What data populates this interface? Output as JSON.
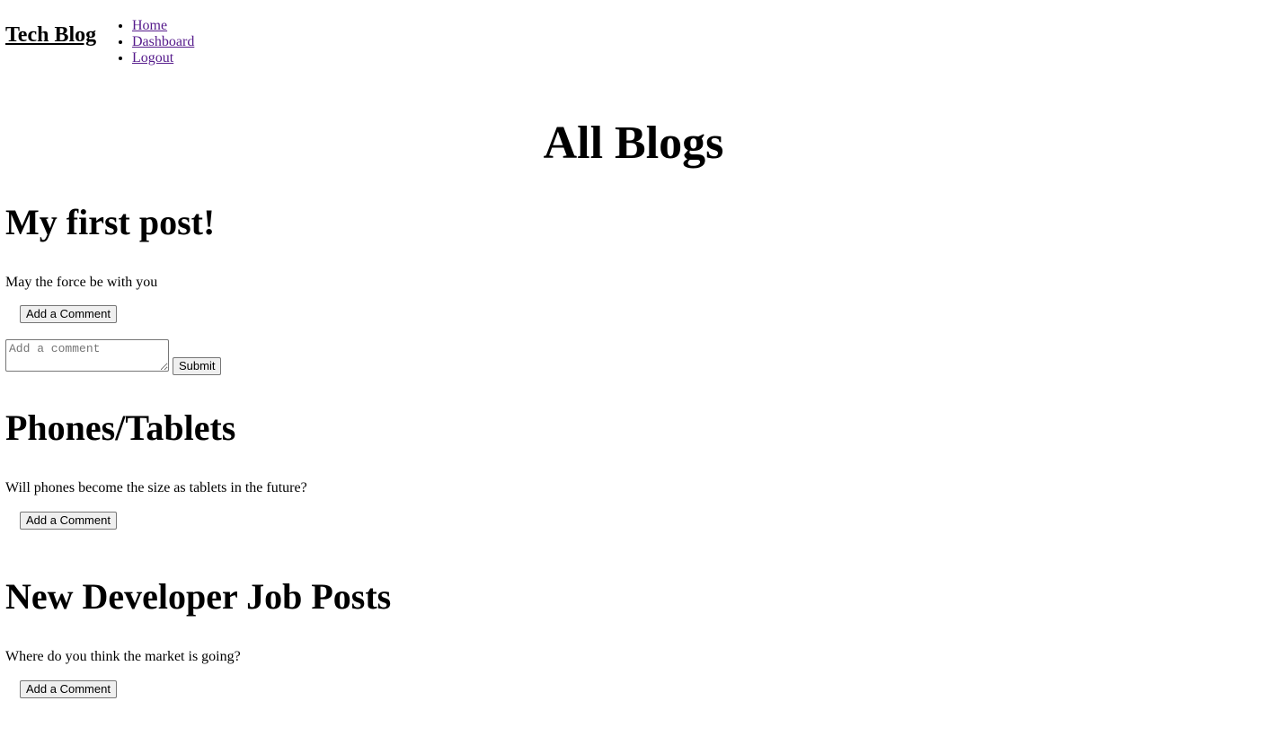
{
  "header": {
    "brand": "Tech Blog",
    "nav": [
      {
        "label": "Home"
      },
      {
        "label": "Dashboard"
      },
      {
        "label": "Logout"
      }
    ]
  },
  "main": {
    "title": "All Blogs",
    "posts": [
      {
        "title": "My first post!",
        "body": "May the force be with you",
        "add_comment_label": "Add a Comment",
        "comment_placeholder": "Add a comment",
        "submit_label": "Submit"
      },
      {
        "title": "Phones/Tablets",
        "body": "Will phones become the size as tablets in the future?",
        "add_comment_label": "Add a Comment"
      },
      {
        "title": "New Developer Job Posts",
        "body": "Where do you think the market is going?",
        "add_comment_label": "Add a Comment"
      }
    ]
  }
}
